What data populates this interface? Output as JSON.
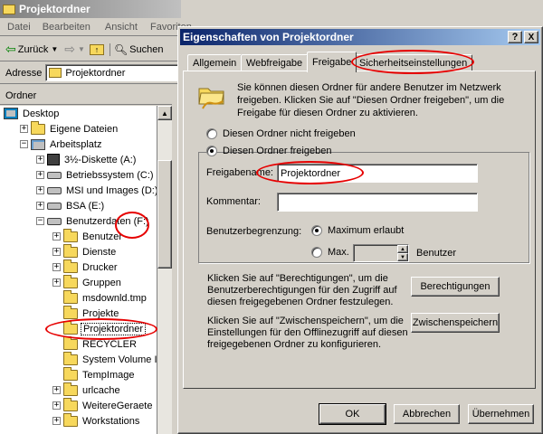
{
  "explorer": {
    "title": "Projektordner",
    "menu": [
      "Datei",
      "Bearbeiten",
      "Ansicht",
      "Favoriten"
    ],
    "toolbar": {
      "back": "Zurück",
      "search": "Suchen"
    },
    "address_label": "Adresse",
    "address_value": "Projektordner",
    "folders_header": "Ordner",
    "tree": [
      {
        "label": "Desktop",
        "indent": 0,
        "icon": "desktop",
        "exp": ""
      },
      {
        "label": "Eigene Dateien",
        "indent": 1,
        "icon": "folder",
        "exp": "+"
      },
      {
        "label": "Arbeitsplatz",
        "indent": 1,
        "icon": "computer",
        "exp": "−"
      },
      {
        "label": "3½-Diskette (A:)",
        "indent": 2,
        "icon": "floppy",
        "exp": "+"
      },
      {
        "label": "Betriebssystem (C:)",
        "indent": 2,
        "icon": "drive",
        "exp": "+"
      },
      {
        "label": "MSI und Images (D:)",
        "indent": 2,
        "icon": "drive",
        "exp": "+"
      },
      {
        "label": "BSA (E:)",
        "indent": 2,
        "icon": "drive",
        "exp": "+"
      },
      {
        "label": "Benutzerdaten (F:)",
        "indent": 2,
        "icon": "drive",
        "exp": "−"
      },
      {
        "label": "Benutzer",
        "indent": 3,
        "icon": "folder",
        "exp": "+"
      },
      {
        "label": "Dienste",
        "indent": 3,
        "icon": "folder",
        "exp": "+"
      },
      {
        "label": "Drucker",
        "indent": 3,
        "icon": "folder",
        "exp": "+"
      },
      {
        "label": "Gruppen",
        "indent": 3,
        "icon": "folder",
        "exp": "+"
      },
      {
        "label": "msdownld.tmp",
        "indent": 3,
        "icon": "folder",
        "exp": ""
      },
      {
        "label": "Projekte",
        "indent": 3,
        "icon": "folder",
        "exp": ""
      },
      {
        "label": "Projektordner",
        "indent": 3,
        "icon": "folder",
        "exp": "",
        "selected": true
      },
      {
        "label": "RECYCLER",
        "indent": 3,
        "icon": "folder",
        "exp": ""
      },
      {
        "label": "System Volume Infor",
        "indent": 3,
        "icon": "folder",
        "exp": ""
      },
      {
        "label": "TempImage",
        "indent": 3,
        "icon": "folder",
        "exp": ""
      },
      {
        "label": "urlcache",
        "indent": 3,
        "icon": "folder",
        "exp": "+"
      },
      {
        "label": "WeitereGeraete",
        "indent": 3,
        "icon": "folder",
        "exp": "+"
      },
      {
        "label": "Workstations",
        "indent": 3,
        "icon": "folder",
        "exp": "+"
      }
    ]
  },
  "dialog": {
    "title": "Eigenschaften von Projektordner",
    "help_btn": "?",
    "close_btn": "X",
    "tabs": [
      "Allgemein",
      "Webfreigabe",
      "Freigabe",
      "Sicherheitseinstellungen"
    ],
    "description": "Sie können diesen Ordner für andere Benutzer im Netzwerk freigeben. Klicken Sie auf \"Diesen Ordner freigeben\", um die Freigabe für diesen Ordner zu aktivieren.",
    "radio_not_share": "Diesen Ordner nicht freigeben",
    "radio_share": "Diesen Ordner freigeben",
    "share_name_label": "Freigabename:",
    "share_name_value": "Projektordner",
    "comment_label": "Kommentar:",
    "comment_value": "",
    "user_limit_label": "Benutzerbegrenzung:",
    "max_allowed": "Maximum erlaubt",
    "max_label": "Max.",
    "users_label": "Benutzer",
    "permissions_text": "Klicken Sie auf \"Berechtigungen\", um die Benutzerberechtigungen für den Zugriff auf diesen freigegebenen Ordner festzulegen.",
    "permissions_btn": "Berechtigungen",
    "cache_text": "Klicken Sie auf \"Zwischenspeichern\", um die Einstellungen für den Offlinezugriff auf diesen freigegebenen Ordner zu konfigurieren.",
    "cache_btn": "Zwischenspeichern",
    "ok": "OK",
    "cancel": "Abbrechen",
    "apply": "Übernehmen"
  }
}
